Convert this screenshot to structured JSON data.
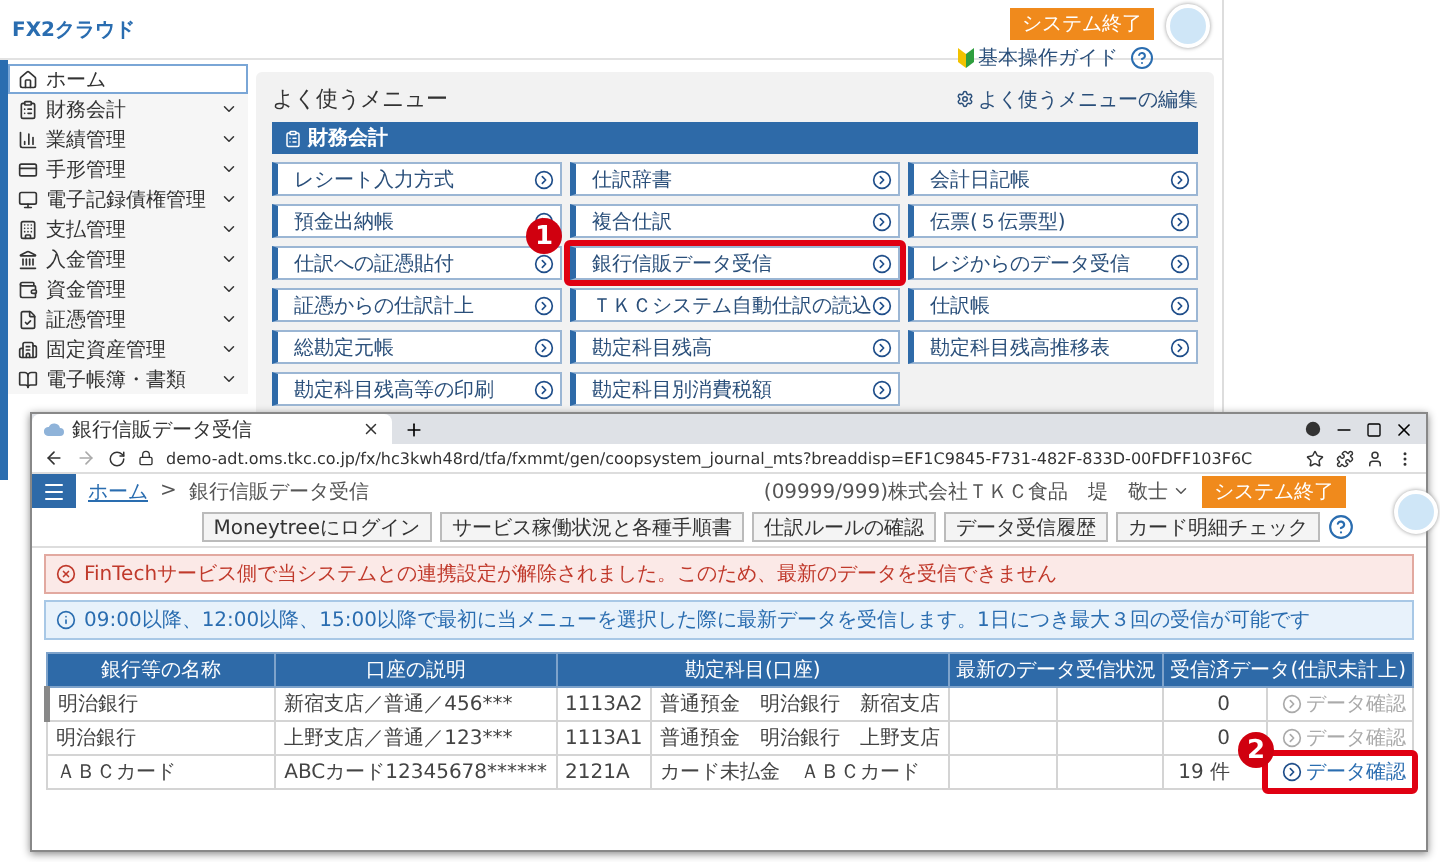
{
  "app": {
    "logo": "FX2クラウド",
    "exit_button": "システム終了",
    "guide_link": "基本操作ガイド"
  },
  "sidebar": {
    "items": [
      {
        "label": "ホーム",
        "selected": true,
        "expandable": false
      },
      {
        "label": "財務会計",
        "selected": false,
        "expandable": true
      },
      {
        "label": "業績管理",
        "selected": false,
        "expandable": true
      },
      {
        "label": "手形管理",
        "selected": false,
        "expandable": true
      },
      {
        "label": "電子記録債権管理",
        "selected": false,
        "expandable": true
      },
      {
        "label": "支払管理",
        "selected": false,
        "expandable": true
      },
      {
        "label": "入金管理",
        "selected": false,
        "expandable": true
      },
      {
        "label": "資金管理",
        "selected": false,
        "expandable": true
      },
      {
        "label": "証憑管理",
        "selected": false,
        "expandable": true
      },
      {
        "label": "固定資産管理",
        "selected": false,
        "expandable": true
      },
      {
        "label": "電子帳簿・書類",
        "selected": false,
        "expandable": true
      }
    ]
  },
  "menu": {
    "title": "よく使うメニュー",
    "edit_link": "よく使うメニューの編集",
    "section": "財務会計",
    "items": [
      {
        "label": "レシート入力方式"
      },
      {
        "label": "仕訳辞書"
      },
      {
        "label": "会計日記帳"
      },
      {
        "label": "預金出納帳"
      },
      {
        "label": "複合仕訳"
      },
      {
        "label": "伝票(５伝票型)"
      },
      {
        "label": "仕訳への証憑貼付"
      },
      {
        "label": "銀行信販データ受信",
        "callout": "1"
      },
      {
        "label": "レジからのデータ受信"
      },
      {
        "label": "証憑からの仕訳計上"
      },
      {
        "label": "ＴＫＣシステム自動仕訳の読込"
      },
      {
        "label": "仕訳帳"
      },
      {
        "label": "総勘定元帳"
      },
      {
        "label": "勘定科目残高"
      },
      {
        "label": "勘定科目残高推移表"
      },
      {
        "label": "勘定科目残高等の印刷"
      },
      {
        "label": "勘定科目別消費税額"
      }
    ]
  },
  "browser": {
    "tab_title": "銀行信販データ受信",
    "url": "demo-adt.oms.tkc.co.jp/fx/hc3kwh48rd/tfa/fxmmt/gen/coopsystem_journal_mts?breaddisp=EF1C9845-F731-482F-833D-00FDFF103F6C",
    "breadcrumb": [
      "ホーム",
      "銀行信販データ受信"
    ],
    "separator": ">",
    "user": "(09999/999)株式会社ＴＫＣ食品　堤　敬士",
    "exit_button": "システム終了",
    "toolbar_buttons": [
      "Moneytreeにログイン",
      "サービス稼働状況と各種手順書",
      "仕訳ルールの確認",
      "データ受信履歴",
      "カード明細チェック"
    ],
    "alerts": [
      {
        "kind": "error",
        "text": "FinTechサービス側で当システムとの連携設定が解除されました。このため、最新のデータを受信できません"
      },
      {
        "kind": "info",
        "text": "09:00以降、12:00以降、15:00以降で最初に当メニューを選択した際に最新データを受信します。1日につき最大３回の受信が可能です"
      }
    ],
    "table": {
      "columns": [
        "銀行等の名称",
        "口座の説明",
        "勘定科目(口座)",
        "最新のデータ受信状況",
        "受信済データ(仕訳未計上)"
      ],
      "rows": [
        {
          "selected": true,
          "bank": "明治銀行",
          "account": "新宿支店／普通／456***",
          "code": "1113A2",
          "title": "普通預金　明治銀行　新宿支店",
          "count": "0",
          "link": "データ確認",
          "enabled": false
        },
        {
          "selected": false,
          "bank": "明治銀行",
          "account": "上野支店／普通／123***",
          "code": "1113A1",
          "title": "普通預金　明治銀行　上野支店",
          "count": "0",
          "link": "データ確認",
          "enabled": false
        },
        {
          "selected": false,
          "bank": "ＡＢＣカード",
          "account": "ABCカード12345678******",
          "code": "2121A",
          "title": "カード未払金　ＡＢＣカード",
          "count": "19 件",
          "link": "データ確認",
          "enabled": true,
          "callout": "2"
        }
      ]
    }
  }
}
